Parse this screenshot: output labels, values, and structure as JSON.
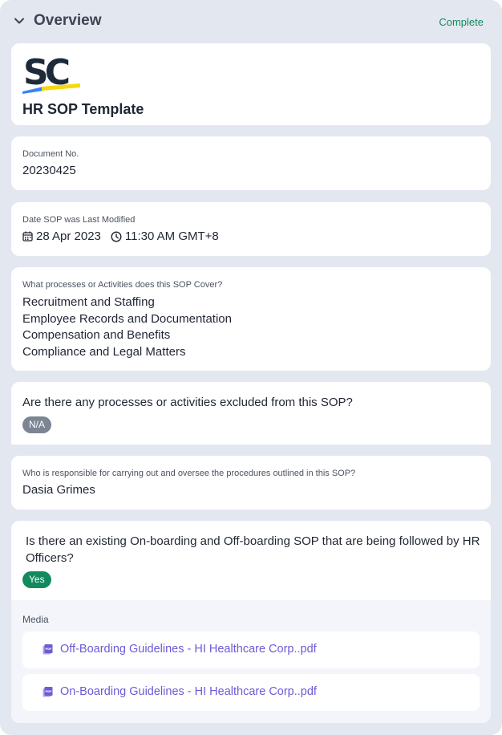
{
  "section": {
    "title": "Overview",
    "status": "Complete"
  },
  "document": {
    "logo": "SC",
    "title": "HR SOP Template"
  },
  "doc_number": {
    "label": "Document No.",
    "value": "20230425"
  },
  "last_modified": {
    "label": "Date SOP was Last Modified",
    "date": "28 Apr 2023",
    "time": "11:30 AM GMT+8",
    "date_icon": "calendar-icon",
    "time_icon": "clock-icon"
  },
  "processes": {
    "label": "What processes or Activities does this SOP Cover?",
    "items": [
      "Recruitment and Staffing",
      "Employee Records and Documentation",
      "Compensation and Benefits",
      "Compliance and Legal Matters"
    ]
  },
  "exclusions": {
    "question": "Are there any processes or activities excluded from this SOP?",
    "answer": "N/A"
  },
  "responsible": {
    "label": "Who is responsible for carrying out and oversee the procedures outlined in this SOP?",
    "value": "Dasia Grimes"
  },
  "onboarding": {
    "question": "Is there an existing On-boarding and Off-boarding SOP that are being followed by HR Officers?",
    "answer": "Yes",
    "media_label": "Media",
    "files": [
      {
        "name": "Off-Boarding Guidelines - HI Healthcare Corp..pdf",
        "icon": "pdf-icon"
      },
      {
        "name": "On-Boarding Guidelines - HI Healthcare Corp..pdf",
        "icon": "pdf-icon"
      }
    ]
  },
  "colors": {
    "panel_bg": "#e3e7f0",
    "complete_green": "#138a5e",
    "na_grey": "#7c8593",
    "link_purple": "#6a5bd6",
    "logo_dark": "#1e2a3a",
    "logo_stripe_blue": "#3b82f6",
    "logo_stripe_yellow": "#f5d90a"
  }
}
